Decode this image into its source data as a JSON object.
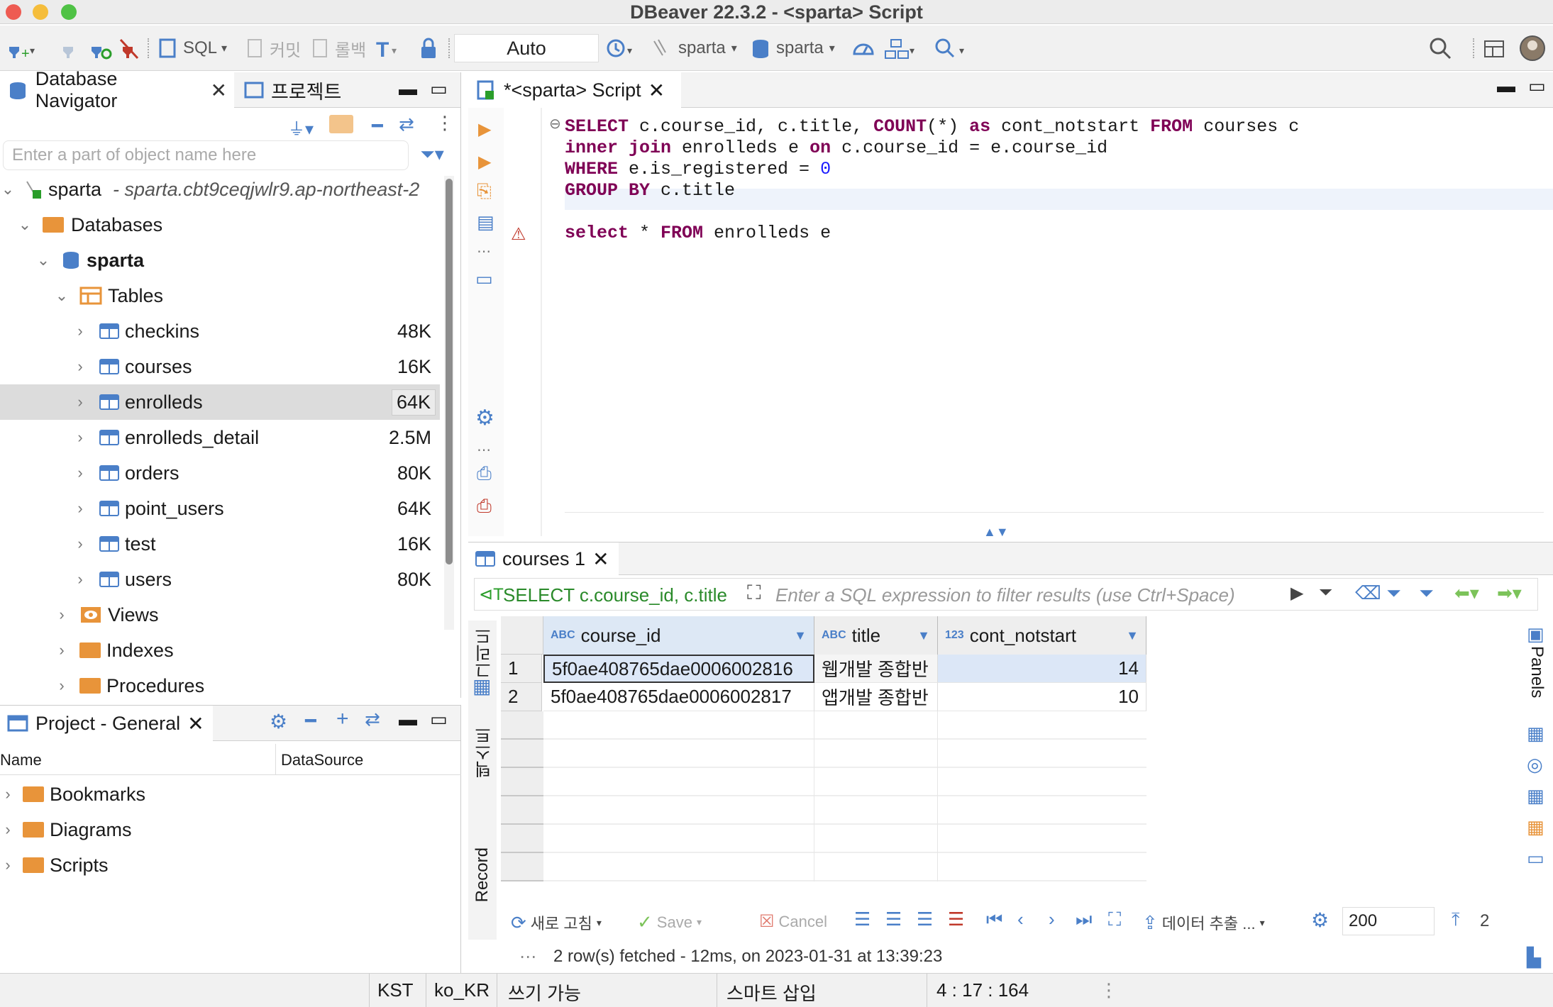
{
  "window": {
    "title": "DBeaver 22.3.2 - <sparta> Script"
  },
  "toolbar": {
    "sql_label": "SQL",
    "commit_label": "커밋",
    "rollback_label": "롤백",
    "transaction_mode": "Auto",
    "datasource": "sparta",
    "schema": "sparta"
  },
  "navigator": {
    "tab_label": "Database Navigator",
    "projects_tab_label": "프로젝트",
    "filter_placeholder": "Enter a part of object name here",
    "connection": {
      "name": "sparta",
      "host": "- sparta.cbt9ceqjwlr9.ap-northeast-2"
    },
    "databases_label": "Databases",
    "database_name": "sparta",
    "tables_label": "Tables",
    "tables": [
      {
        "name": "checkins",
        "size": "48K"
      },
      {
        "name": "courses",
        "size": "16K"
      },
      {
        "name": "enrolleds",
        "size": "64K"
      },
      {
        "name": "enrolleds_detail",
        "size": "2.5M"
      },
      {
        "name": "orders",
        "size": "80K"
      },
      {
        "name": "point_users",
        "size": "64K"
      },
      {
        "name": "test",
        "size": "16K"
      },
      {
        "name": "users",
        "size": "80K"
      }
    ],
    "views_label": "Views",
    "indexes_label": "Indexes",
    "procedures_label": "Procedures"
  },
  "project": {
    "tab_label": "Project - General",
    "col_name": "Name",
    "col_datasource": "DataSource",
    "items": [
      "Bookmarks",
      "Diagrams",
      "Scripts"
    ]
  },
  "editor": {
    "tab_label": "*<sparta> Script",
    "lines": {
      "l1": {
        "kw1": "SELECT",
        "t1": " c.course_id, c.title, ",
        "kw2": "COUNT",
        "t2": "(*) ",
        "kw3": "as",
        "t3": " cont_notstart ",
        "kw4": "FROM",
        "t4": " courses c"
      },
      "l2": {
        "kw1": "inner join",
        "t1": " enrolleds e ",
        "kw2": "on",
        "t2": " c.course_id = e.course_id"
      },
      "l3": {
        "kw1": "WHERE",
        "t1": " e.is_registered = ",
        "num": "0"
      },
      "l4": {
        "kw1": "GROUP BY",
        "t1": " c.title"
      },
      "l6": {
        "kw1": "select",
        "t1": " * ",
        "kw2": "FROM",
        "t2": " enrolleds e"
      }
    }
  },
  "results": {
    "tab_label": "courses 1",
    "query_label": "SELECT c.course_id, c.title",
    "filter_placeholder": "Enter a SQL expression to filter results (use Ctrl+Space)",
    "columns": [
      {
        "type": "ABC",
        "name": "course_id"
      },
      {
        "type": "ABC",
        "name": "title"
      },
      {
        "type": "123",
        "name": "cont_notstart"
      }
    ],
    "rows": [
      {
        "n": "1",
        "course_id": "5f0ae408765dae0006002816",
        "title": "웹개발 종합반",
        "cont_notstart": "14"
      },
      {
        "n": "2",
        "course_id": "5f0ae408765dae0006002817",
        "title": "앱개발 종합반",
        "cont_notstart": "10"
      }
    ],
    "side_tabs": {
      "grid": "그리드",
      "text": "텍스트",
      "record": "Record"
    },
    "panels_label": "Panels",
    "bottom": {
      "refresh": "새로 고침",
      "save": "Save",
      "cancel": "Cancel",
      "export": "데이터 추출 ...",
      "fetch_size": "200",
      "count": "2"
    },
    "status_message": "2 row(s) fetched - 12ms, on 2023-01-31 at 13:39:23"
  },
  "statusbar": {
    "timezone": "KST",
    "locale": "ko_KR",
    "mode": "쓰기 가능",
    "insert": "스마트 삽입",
    "position": "4 : 17 : 164"
  }
}
